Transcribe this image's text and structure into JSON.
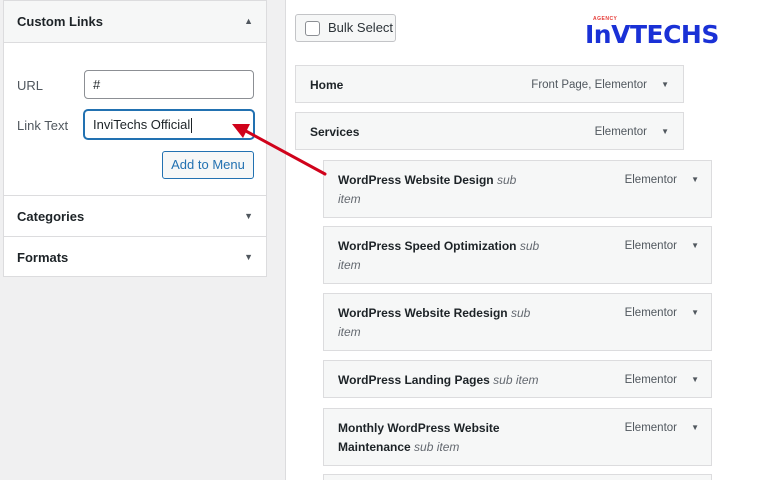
{
  "sidebar": {
    "custom_links": {
      "title": "Custom Links",
      "url_label": "URL",
      "url_value": "#",
      "link_text_label": "Link Text",
      "link_text_value": "InviTechs Official",
      "add_button": "Add to Menu"
    },
    "categories": {
      "title": "Categories"
    },
    "formats": {
      "title": "Formats"
    }
  },
  "menu": {
    "bulk_select": "Bulk Select",
    "items": [
      {
        "title": "Home",
        "type": "Front Page, Elementor"
      },
      {
        "title": "Services",
        "type": "Elementor"
      }
    ],
    "sub_items": [
      {
        "title": "WordPress Website Design",
        "sub_label": "sub item",
        "type": "Elementor"
      },
      {
        "title": "WordPress Speed Optimization",
        "sub_label": "sub item",
        "type": "Elementor"
      },
      {
        "title": "WordPress Website Redesign",
        "sub_label": "sub item",
        "type": "Elementor"
      },
      {
        "title": "WordPress Landing Pages",
        "sub_label": "sub item",
        "type": "Elementor"
      },
      {
        "title": "Monthly WordPress Website Maintenance",
        "sub_label": "sub item",
        "type": "Elementor"
      }
    ]
  },
  "branding": {
    "logo_text": "InVTECHS",
    "logo_tag": "AGENCY",
    "logo_color": "#1a31d6"
  },
  "annotation": {
    "arrow_color": "#d0021b"
  },
  "icons": {
    "collapse": "chevron-up-icon",
    "expand": "chevron-down-icon"
  }
}
